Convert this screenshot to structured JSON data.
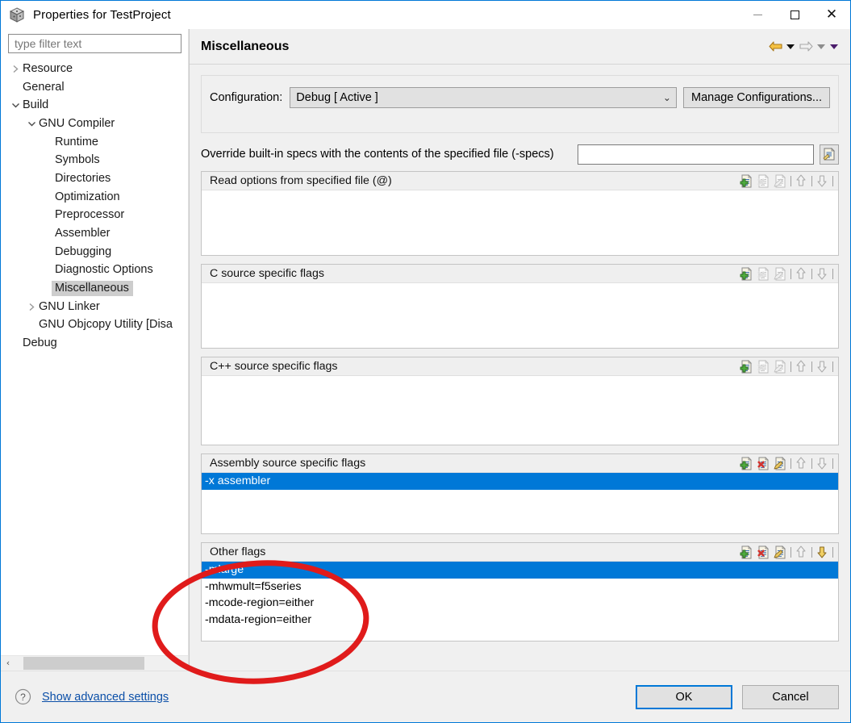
{
  "window": {
    "title": "Properties for TestProject",
    "icon": "project-cube-icon",
    "minimize_label": "Minimize",
    "maximize_label": "Maximize",
    "close_label": "Close"
  },
  "sidebar": {
    "filter_placeholder": "type filter text",
    "filter_value": "",
    "items": [
      {
        "label": "Resource",
        "indent": 0,
        "twisty": "collapsed",
        "selected": false
      },
      {
        "label": "General",
        "indent": 0,
        "twisty": "none",
        "selected": false
      },
      {
        "label": "Build",
        "indent": 0,
        "twisty": "expanded",
        "selected": false
      },
      {
        "label": "GNU Compiler",
        "indent": 1,
        "twisty": "expanded",
        "selected": false
      },
      {
        "label": "Runtime",
        "indent": 2,
        "twisty": "none",
        "selected": false
      },
      {
        "label": "Symbols",
        "indent": 2,
        "twisty": "none",
        "selected": false
      },
      {
        "label": "Directories",
        "indent": 2,
        "twisty": "none",
        "selected": false
      },
      {
        "label": "Optimization",
        "indent": 2,
        "twisty": "none",
        "selected": false
      },
      {
        "label": "Preprocessor",
        "indent": 2,
        "twisty": "none",
        "selected": false
      },
      {
        "label": "Assembler",
        "indent": 2,
        "twisty": "none",
        "selected": false
      },
      {
        "label": "Debugging",
        "indent": 2,
        "twisty": "none",
        "selected": false
      },
      {
        "label": "Diagnostic Options",
        "indent": 2,
        "twisty": "none",
        "selected": false
      },
      {
        "label": "Miscellaneous",
        "indent": 2,
        "twisty": "none",
        "selected": true
      },
      {
        "label": "GNU Linker",
        "indent": 1,
        "twisty": "collapsed",
        "selected": false
      },
      {
        "label": "GNU Objcopy Utility  [Disa",
        "indent": 1,
        "twisty": "none",
        "selected": false
      },
      {
        "label": "Debug",
        "indent": 0,
        "twisty": "none",
        "selected": false
      }
    ],
    "scrollbar": {
      "left_arrow": "‹",
      "right_arrow": "›"
    }
  },
  "page": {
    "title": "Miscellaneous",
    "nav": {
      "back_label": "Back",
      "back_dropdown_label": "Back history",
      "forward_label": "Forward",
      "forward_dropdown_label": "Forward history",
      "menu_label": "View menu"
    }
  },
  "configuration": {
    "label": "Configuration:",
    "value": "Debug  [ Active ]",
    "chevron": "⌄",
    "manage_button": "Manage Configurations..."
  },
  "specs": {
    "label": "Override built-in specs with the contents of the specified file (-specs)",
    "value": "",
    "browse_icon": "file-browse-icon"
  },
  "sections": [
    {
      "title": "Read options from specified file (@)",
      "items": [],
      "selected_index": -1,
      "tools": {
        "add": true,
        "delete": false,
        "edit": false,
        "move_up": false,
        "move_down": false
      }
    },
    {
      "title": "C source specific flags",
      "items": [],
      "selected_index": -1,
      "tools": {
        "add": true,
        "delete": false,
        "edit": false,
        "move_up": false,
        "move_down": false
      }
    },
    {
      "title": "C++ source specific flags",
      "items": [],
      "selected_index": -1,
      "tools": {
        "add": true,
        "delete": false,
        "edit": false,
        "move_up": false,
        "move_down": false
      }
    },
    {
      "title": "Assembly source specific flags",
      "items": [
        "-x assembler"
      ],
      "selected_index": 0,
      "tools": {
        "add": true,
        "delete": true,
        "edit": true,
        "move_up": false,
        "move_down": false
      }
    },
    {
      "title": "Other flags",
      "items": [
        "-mlarge",
        "-mhwmult=f5series",
        "-mcode-region=either",
        "-mdata-region=either"
      ],
      "selected_index": 0,
      "tools": {
        "add": true,
        "delete": true,
        "edit": true,
        "move_up": false,
        "move_down": true
      }
    }
  ],
  "footer": {
    "help_icon": "help-question-icon",
    "advanced_link": "Show advanced settings",
    "ok_button": "OK",
    "cancel_button": "Cancel"
  },
  "annotation": {
    "shape": "ellipse",
    "color": "#e01b1b",
    "target": "Other flags list"
  },
  "colors": {
    "window_border": "#0078d7",
    "selection": "#0078d7",
    "link": "#0b4fa8",
    "panel": "#f0f0f0",
    "tree_selection": "#cdcdcd",
    "annotation": "#e01b1b"
  }
}
